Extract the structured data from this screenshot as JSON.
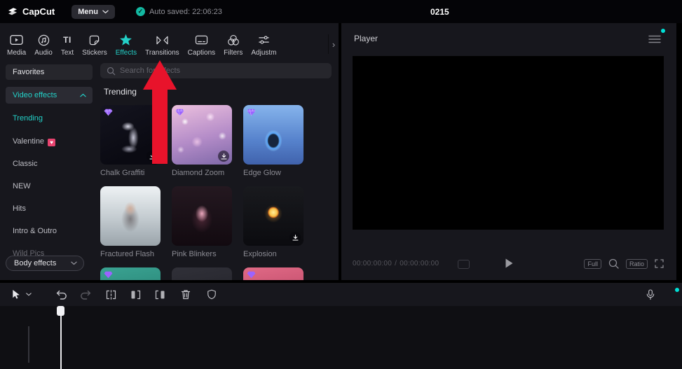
{
  "colors": {
    "accent": "#23d1c8",
    "vip": "#9b63ff",
    "arrow": "#e8132b",
    "save_check": "#13b9a2"
  },
  "topbar": {
    "logo_text": "CapCut",
    "menu_label": "Menu",
    "check_glyph": "✓",
    "autosave_text": "Auto saved: 22:06:23",
    "project_title": "0215"
  },
  "toolbar": {
    "tabs": [
      {
        "label": "Media"
      },
      {
        "label": "Audio"
      },
      {
        "label": "Text",
        "glyph": "TI"
      },
      {
        "label": "Stickers"
      },
      {
        "label": "Effects",
        "active": true
      },
      {
        "label": "Transitions"
      },
      {
        "label": "Captions"
      },
      {
        "label": "Filters"
      },
      {
        "label": "Adjustm"
      }
    ],
    "expand_glyph": "›"
  },
  "sidebar": {
    "favorites_label": "Favorites",
    "group_label": "Video effects",
    "items": [
      {
        "label": "Trending",
        "active": true
      },
      {
        "label": "Valentine",
        "badge": "♥"
      },
      {
        "label": "Classic"
      },
      {
        "label": "NEW"
      },
      {
        "label": "Hits"
      },
      {
        "label": "Intro & Outro"
      },
      {
        "label": "Wild Pics"
      }
    ],
    "body_effects_label": "Body effects"
  },
  "effects_panel": {
    "search_placeholder": "Search for effects",
    "section_title": "Trending",
    "cards": [
      {
        "name": "Chalk Graffiti",
        "thumb": "background:radial-gradient(ellipse 13px 9px at 46% 36%, rgba(238,238,252,.9), rgba(238,238,252,0) 70%),radial-gradient(ellipse 10px 22px at 55% 55%, rgba(228,228,246,.85), rgba(228,228,246,0) 72%),radial-gradient(ellipse 16px 8px at 48% 74%, rgba(222,222,242,.7), rgba(222,222,242,0) 70%),linear-gradient(155deg,#14141f,#0a0a12 75%)"
      },
      {
        "name": "Diamond Zoom",
        "thumb": "background:radial-gradient(circle 7px at 22% 28%, rgba(255,255,255,.95), rgba(255,255,255,0) 70%),radial-gradient(circle 9px at 64% 20%, rgba(255,235,250,.85), rgba(255,235,250,0) 70%),radial-gradient(circle 8px at 84% 52%, rgba(255,255,255,.8), rgba(255,255,255,0) 70%),radial-gradient(circle 11px at 42% 62%, rgba(255,215,240,.7), rgba(255,215,240,0) 70%),radial-gradient(circle 7px at 15% 75%, rgba(255,240,250,.65), rgba(255,240,250,0) 70%),linear-gradient(165deg,#ecc0de,#b48cc8 55%,#7e68a8)"
      },
      {
        "name": "Edge Glow",
        "thumb": "background:radial-gradient(ellipse 17px 21px at 50% 60%, #16263e 42%, rgba(90,170,255,.95) 52%, rgba(130,200,255,.4) 64%, rgba(130,200,255,0) 74%),linear-gradient(180deg,#86b4ec,#5682cc 60%,#4062ac)"
      },
      {
        "name": "Fractured Flash",
        "thumb": "background:radial-gradient(ellipse 12px 14px at 50% 38%, #cfac9a, rgba(207,172,154,0) 72%),radial-gradient(ellipse 18px 26px at 50% 55%, rgba(70,60,62,.55), rgba(70,60,62,0) 72%),linear-gradient(180deg,#eef2f4,#c2cacf 55%,#9aa4aa)"
      },
      {
        "name": "Pink Blinkers",
        "thumb": "background:radial-gradient(ellipse 13px 17px at 50% 46%, #eba8bd, rgba(235,168,189,0) 70%),radial-gradient(ellipse 20px 26px at 50% 55%, rgba(120,60,80,.5), rgba(120,60,80,0) 75%),linear-gradient(180deg,#241820,#120a10)"
      },
      {
        "name": "Explosion",
        "thumb": "background:radial-gradient(circle 10px at 50% 44%, #ffef9a, #f8c046 55%, rgba(220,110,30,.85) 72%, rgba(220,110,30,0) 82%),radial-gradient(circle 16px at 50% 46%, rgba(250,170,60,.5), rgba(250,170,60,0) 80%),linear-gradient(180deg,#191a1e,#0b0b0f)"
      }
    ],
    "partial_cards": [
      {
        "thumb": "background:radial-gradient(ellipse 16px 10px at 50% 80%, rgba(240,250,248,.75), rgba(240,250,248,0) 70%),linear-gradient(170deg,#3aa392,#1d6e62)"
      },
      {
        "thumb": "background:linear-gradient(170deg,#303038,#1c1c23)"
      },
      {
        "thumb": "background:radial-gradient(ellipse 16px 10px at 55% 85%, rgba(255,230,235,.6), rgba(255,230,235,0) 70%),linear-gradient(170deg,#e06a86,#a83454)"
      }
    ]
  },
  "player": {
    "title": "Player",
    "timecode_current": "00:00:00:00",
    "timecode_separator": "/",
    "timecode_total": "00:00:00:00",
    "full_label": "Full",
    "ratio_label": "Ratio"
  }
}
